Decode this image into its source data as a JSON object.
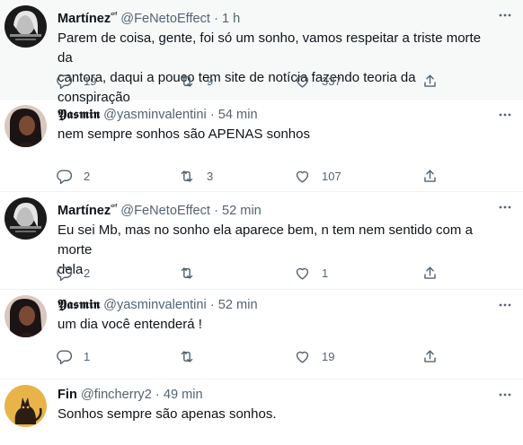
{
  "tweets": [
    {
      "name": "Martínez",
      "name_suffix": "ᶜʳᶠ",
      "handle": "@FeNetoEffect",
      "time": "1 h",
      "text_lines": [
        "Parem de coisa, gente, foi só um sonho, vamos respeitar a triste morte da",
        "cantora, daqui a pouco tem site de notícia fazendo teoria da conspiração"
      ],
      "replies": "19",
      "retweets": "9",
      "likes": "337"
    },
    {
      "name": "𝖄𝖆𝖘𝖒𝖎𝖓",
      "handle": "@yasminvalentini",
      "time": "54 min",
      "text_lines": [
        "nem sempre sonhos são APENAS sonhos"
      ],
      "replies": "2",
      "retweets": "3",
      "likes": "107"
    },
    {
      "name": "Martínez",
      "name_suffix": "ᶜʳᶠ",
      "handle": "@FeNetoEffect",
      "time": "52 min",
      "text_lines": [
        "Eu sei Mb, mas no sonho ela aparece bem, n tem nem sentido com a morte",
        "dela"
      ],
      "replies": "2",
      "retweets": "",
      "likes": "1"
    },
    {
      "name": "𝖄𝖆𝖘𝖒𝖎𝖓",
      "handle": "@yasminvalentini",
      "time": "52 min",
      "text_lines": [
        "um dia você entenderá !"
      ],
      "replies": "1",
      "retweets": "",
      "likes": "19"
    },
    {
      "name": "Fin",
      "handle": "@fincherry2",
      "time": "49 min",
      "text_lines": [
        "Sonhos sempre são apenas sonhos."
      ]
    }
  ],
  "separator": "·",
  "colors": {
    "text": "#0f1419",
    "secondary": "#536471",
    "highlight_bg": "#f7f9f9",
    "border": "#eff3f4"
  },
  "icons": {
    "reply": "reply-icon",
    "retweet": "retweet-icon",
    "like": "heart-icon",
    "share": "share-icon",
    "more": "more-options-icon"
  }
}
